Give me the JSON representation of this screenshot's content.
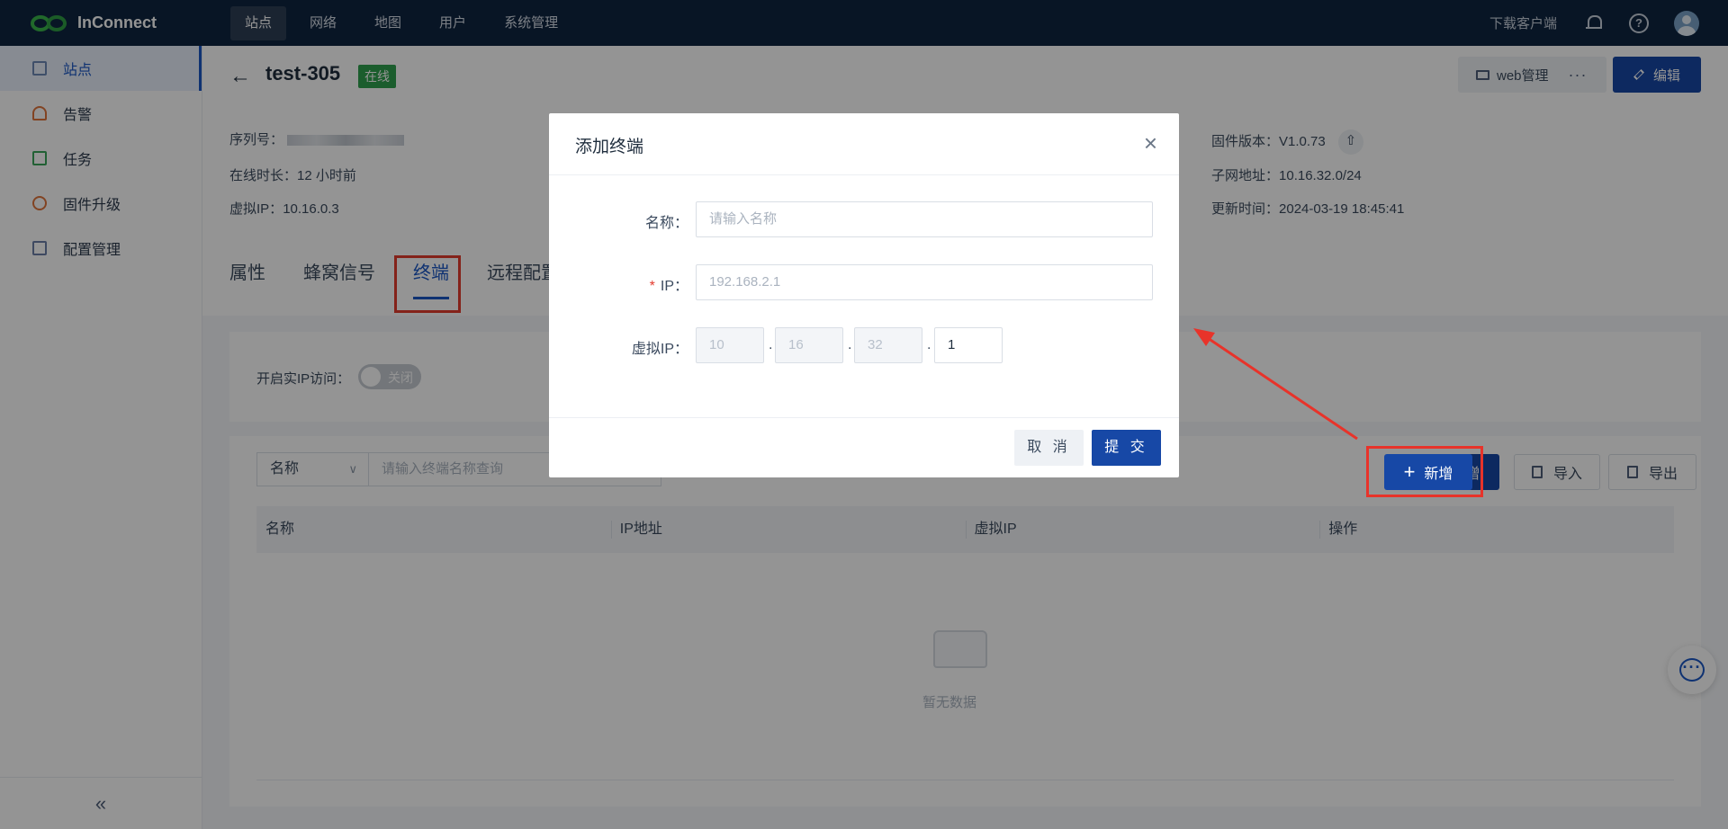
{
  "app": {
    "brand": "InConnect",
    "nav": [
      "站点",
      "网络",
      "地图",
      "用户",
      "系统管理"
    ],
    "download_client": "下载客户端",
    "help_glyph": "?"
  },
  "sidebar": {
    "items": [
      {
        "label": "站点",
        "icon": "site-icon"
      },
      {
        "label": "告警",
        "icon": "alarm-icon"
      },
      {
        "label": "任务",
        "icon": "task-icon"
      },
      {
        "label": "固件升级",
        "icon": "firmware-icon"
      },
      {
        "label": "配置管理",
        "icon": "config-icon"
      }
    ],
    "collapse_glyph": "«"
  },
  "device": {
    "name": "test-305",
    "status": "在线",
    "web_manage": "web管理",
    "more": "···",
    "edit": "编辑",
    "serial_label": "序列号：",
    "online_label": "在线时长：",
    "online_value": "12 小时前",
    "vip_label": "虚拟IP：",
    "vip_value": "10.16.0.3",
    "fw_label": "固件版本：",
    "fw_value": "V1.0.73",
    "subnet_label": "子网地址：",
    "subnet_value": "10.16.32.0/24",
    "updated_label": "更新时间：",
    "updated_value": "2024-03-19 18:45:41"
  },
  "tabs": [
    "属性",
    "蜂窝信号",
    "终端",
    "远程配置"
  ],
  "active_tab": "终端",
  "terminal": {
    "real_ip_label": "开启实IP访问：",
    "switch_text": "关闭",
    "filter_field": "名称",
    "search_placeholder": "请输入终端名称查询",
    "add": "新增",
    "import": "导入",
    "export": "导出",
    "columns": [
      "名称",
      "IP地址",
      "虚拟IP",
      "操作"
    ],
    "empty": "暂无数据"
  },
  "modal": {
    "title": "添加终端",
    "name_label": "名称：",
    "name_placeholder": "请输入名称",
    "ip_label": "IP：",
    "ip_placeholder": "192.168.2.1",
    "vip_label": "虚拟IP：",
    "vip_parts": [
      "10",
      "16",
      "32",
      "1"
    ],
    "cancel": "取 消",
    "submit": "提 交"
  },
  "colors": {
    "topbar": "#0f2540",
    "primary": "#1748a6",
    "online": "#30a14e",
    "annotation": "#e33b2e"
  }
}
